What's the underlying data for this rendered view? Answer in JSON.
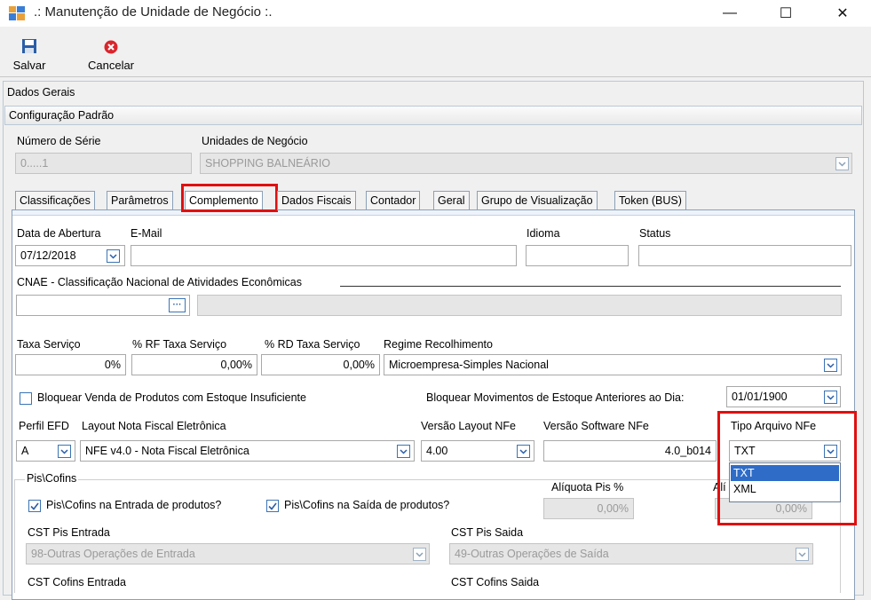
{
  "window": {
    "title": ".: Manutenção de Unidade de Negócio :.",
    "minimize": "—",
    "maximize": "☐",
    "close": "✕"
  },
  "toolbar": {
    "save_label": "Salvar",
    "cancel_label": "Cancelar"
  },
  "sections": {
    "general": "Dados Gerais",
    "default_config": "Configuração Padrão"
  },
  "header_fields": {
    "serial_label": "Número de Série",
    "serial_value": "0.....1",
    "business_units_label": "Unidades de Negócio",
    "business_units_value": "SHOPPING BALNEÁRIO"
  },
  "tabs": [
    "Classificações",
    "Parâmetros",
    "Complemento",
    "Dados Fiscais",
    "Contador",
    "Geral",
    "Grupo de Visualização",
    "Token (BUS)"
  ],
  "active_tab": "Complemento",
  "form": {
    "opening_date_label": "Data de Abertura",
    "opening_date_value": "07/12/2018",
    "email_label": "E-Mail",
    "email_value": "",
    "language_label": "Idioma",
    "language_value": "",
    "status_label": "Status",
    "status_value": "",
    "cnae_label": "CNAE - Classificação Nacional de Atividades Econômicas",
    "cnae_value": "",
    "cnae_desc": "",
    "service_fee_label": "Taxa Serviço",
    "service_fee_value": "0%",
    "rf_fee_label": "% RF Taxa Serviço",
    "rf_fee_value": "0,00%",
    "rd_fee_label": "% RD Taxa Serviço",
    "rd_fee_value": "0,00%",
    "tax_regime_label": "Regime Recolhimento",
    "tax_regime_value": "Microempresa-Simples Nacional",
    "block_sales_label": "Bloquear Venda de Produtos com Estoque Insuficiente",
    "block_movements_label": "Bloquear Movimentos de Estoque Anteriores ao Dia:",
    "block_movements_value": "01/01/1900",
    "efd_profile_label": "Perfil EFD",
    "efd_profile_value": "A",
    "nfe_layout_label": "Layout Nota Fiscal Eletrônica",
    "nfe_layout_value": "NFE v4.0 - Nota Fiscal Eletrônica",
    "nfe_layout_version_label": "Versão Layout NFe",
    "nfe_layout_version_value": "4.00",
    "nfe_software_version_label": "Versão Software NFe",
    "nfe_software_version_value": "4.0_b014",
    "nfe_file_type_label": "Tipo Arquivo NFe",
    "nfe_file_type_value": "TXT",
    "nfe_file_type_options": [
      "TXT",
      "XML"
    ]
  },
  "pis_cofins": {
    "group_label": "Pis\\Cofins",
    "entry_label": "Pis\\Cofins na Entrada de produtos?",
    "exit_label": "Pis\\Cofins na Saída de produtos?",
    "pis_rate_label": "Alíquota Pis %",
    "pis_rate_value": "0,00%",
    "cofins_rate_label": "Alí",
    "cofins_rate_value": "0,00%",
    "cst_pis_entry_label": "CST Pis Entrada",
    "cst_pis_entry_value": "98-Outras Operações de Entrada",
    "cst_pis_exit_label": "CST Pis Saida",
    "cst_pis_exit_value": "49-Outras Operações de Saída",
    "cst_cofins_entry_label": "CST Cofins Entrada",
    "cst_cofins_exit_label": "CST Cofins Saida"
  },
  "colors": {
    "highlight_red": "#e01010",
    "selection_blue": "#2e6cc7"
  }
}
